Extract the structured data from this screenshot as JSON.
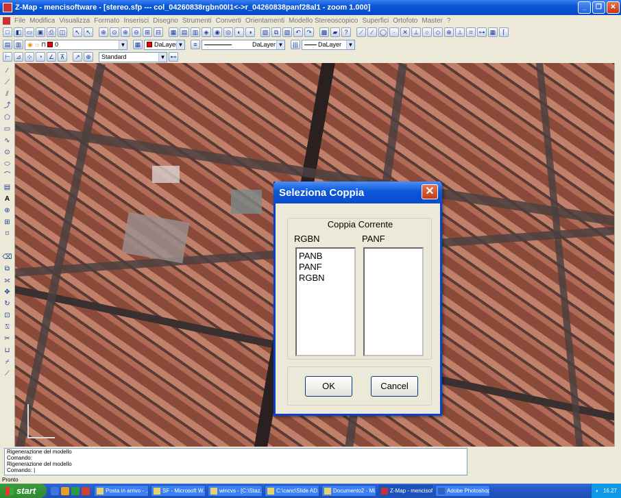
{
  "window": {
    "title": "Z-Map - mencisoftware - [stereo.sfp --- col_04260838rgbn00l1<->r_04260838panf28al1 - zoom 1.000]"
  },
  "menu": [
    "File",
    "Modifica",
    "Visualizza",
    "Formato",
    "Inserisci",
    "Disegno",
    "Strumenti",
    "Converti",
    "Orientamenti",
    "Modello Stereoscopico",
    "Superfici",
    "Ortofoto",
    "Master",
    "?"
  ],
  "toolbar2": {
    "layer_value": "0",
    "color_value": "DaLayer",
    "linetype_value": "DaLayer",
    "lineweight_value": "DaLayer"
  },
  "toolbar3": {
    "style_value": "Standard"
  },
  "dialog": {
    "title": "Seleziona Coppia",
    "group_label": "Coppia Corrente",
    "left_header": "RGBN",
    "right_header": "PANF",
    "left_items": [
      "PANB",
      "PANF",
      "RGBN"
    ],
    "right_items": [],
    "ok_label": "OK",
    "cancel_label": "Cancel"
  },
  "command": {
    "lines": [
      "Rigenerazione del modello",
      "Comando:",
      " Rigenerazione del modello",
      "Comando: |"
    ]
  },
  "status": {
    "text": "Pronto"
  },
  "taskbar": {
    "start_label": "start",
    "tasks": [
      "Posta in arrivo - ...",
      "SF - Microsoft W...",
      "wincvs - [C:\\Staz...",
      "C:\\canc\\Slide AD...",
      "Documento2 - Mi...",
      "Z-Map - mencisof...",
      "Adobe Photoshop"
    ],
    "clock": "16.27"
  },
  "colors": {
    "titlebar": "#0A58D8",
    "dialog_border": "#0842C8",
    "close_button": "#C33D14",
    "taskbar": "#2455C5",
    "start_button": "#3C9B3C"
  }
}
